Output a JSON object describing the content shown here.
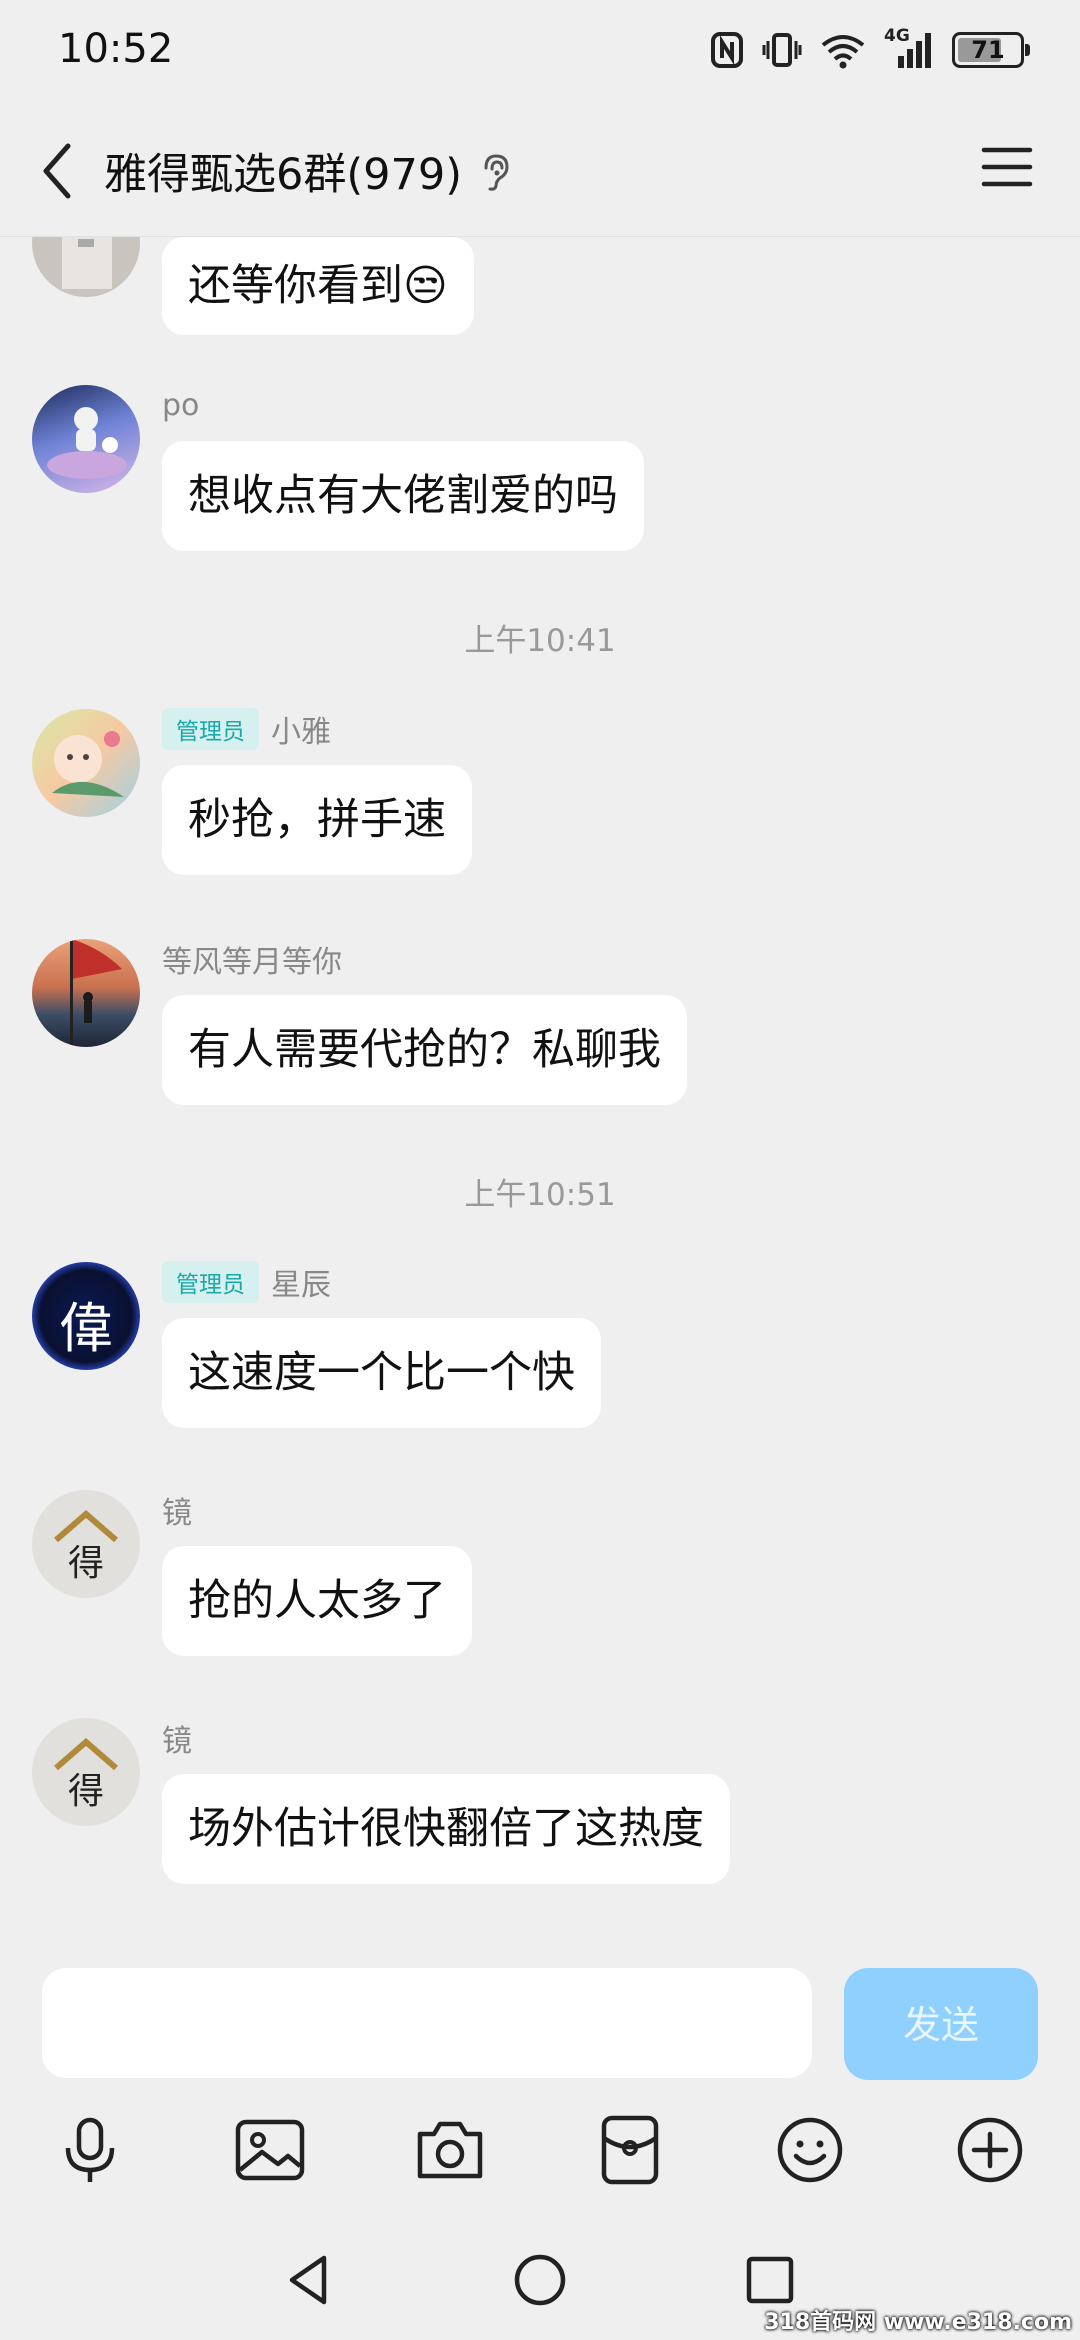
{
  "status_bar": {
    "time": "10:52",
    "network": "4G",
    "battery": "71",
    "battery_level": 0.71
  },
  "header": {
    "title": "雅得甄选6群(979)",
    "icons": [
      "back-arrow-icon",
      "ear-icon",
      "menu-icon"
    ]
  },
  "chat": {
    "partial_message": {
      "text": "还等你看到😒"
    },
    "messages": [
      {
        "sender": "po",
        "role": "",
        "text": "想收点有大佬割爱的吗"
      },
      {
        "sender": "小雅",
        "role": "管理员",
        "text": "秒抢，拼手速"
      },
      {
        "sender": "等风等月等你",
        "role": "",
        "text": "有人需要代抢的？私聊我"
      },
      {
        "sender": "星辰",
        "role": "管理员",
        "text": "这速度一个比一个快"
      },
      {
        "sender": "镜",
        "role": "",
        "text": "抢的人太多了"
      },
      {
        "sender": "镜",
        "role": "",
        "text": "场外估计很快翻倍了这热度"
      }
    ],
    "timestamps": [
      "上午10:41",
      "上午10:51"
    ],
    "avatar_glyphs": {
      "xingchen": "偉",
      "jing": "得"
    }
  },
  "input": {
    "placeholder": "",
    "value": "",
    "send_label": "发送"
  },
  "toolbar": {
    "icons": [
      "microphone-icon",
      "image-icon",
      "camera-icon",
      "red-packet-icon",
      "emoji-icon",
      "plus-icon"
    ]
  },
  "nav": {
    "icons": [
      "nav-back-icon",
      "nav-home-icon",
      "nav-recents-icon"
    ]
  },
  "watermark": "318首码网 www.e318.com",
  "colors": {
    "background": "#efefef",
    "bubble": "#ffffff",
    "send_button": "#8fd0ff",
    "admin_badge_bg": "#d6efef",
    "admin_badge_text": "#1aa8a8"
  }
}
